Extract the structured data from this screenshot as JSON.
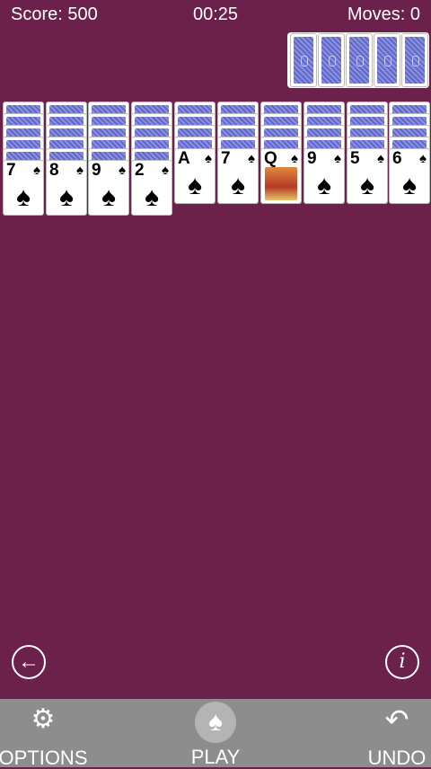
{
  "hud": {
    "score": "Score: 500",
    "time": "00:25",
    "moves": "Moves: 0"
  },
  "stock": {
    "remaining_deals": 5
  },
  "tableau": {
    "suit": "♠",
    "columns": [
      {
        "hidden": 5,
        "rank": "7"
      },
      {
        "hidden": 5,
        "rank": "8"
      },
      {
        "hidden": 5,
        "rank": "9"
      },
      {
        "hidden": 5,
        "rank": "2"
      },
      {
        "hidden": 4,
        "rank": "A"
      },
      {
        "hidden": 4,
        "rank": "7"
      },
      {
        "hidden": 4,
        "rank": "Q"
      },
      {
        "hidden": 4,
        "rank": "9"
      },
      {
        "hidden": 4,
        "rank": "5"
      },
      {
        "hidden": 4,
        "rank": "6"
      }
    ]
  },
  "controls": {
    "back_glyph": "←",
    "info_glyph": "i",
    "options_label": "OPTIONS",
    "options_glyph": "⚙",
    "play_label": "PLAY",
    "play_glyph": "♠",
    "undo_label": "UNDO",
    "undo_glyph": "↶"
  },
  "colors": {
    "background": "#6b2149",
    "bottom_bar": "#8d8d8d",
    "card_back": "#5f67c8"
  }
}
